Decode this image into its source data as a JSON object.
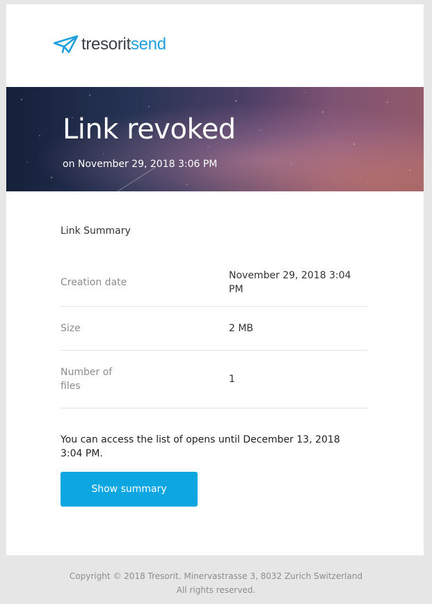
{
  "brand": {
    "name_part1": "tresorit",
    "name_part2": "send",
    "accent": "#21a0dc",
    "icon": "paper-plane-icon"
  },
  "hero": {
    "title": "Link revoked",
    "subtitle": "on November 29, 2018 3:06 PM"
  },
  "summary": {
    "title": "Link Summary",
    "rows": [
      {
        "label": "Creation date",
        "value": "November 29, 2018 3:04 PM"
      },
      {
        "label": "Size",
        "value": "2 MB"
      },
      {
        "label": "Number of files",
        "value": "1"
      }
    ]
  },
  "note": "You can access the list of opens until December 13, 2018 3:04 PM.",
  "button": {
    "label": "Show summary",
    "color": "#0ea6e0"
  },
  "footer": {
    "line1": "Copyright © 2018 Tresorit. Minervastrasse 3, 8032 Zurich Switzerland",
    "line2": "All rights reserved."
  }
}
